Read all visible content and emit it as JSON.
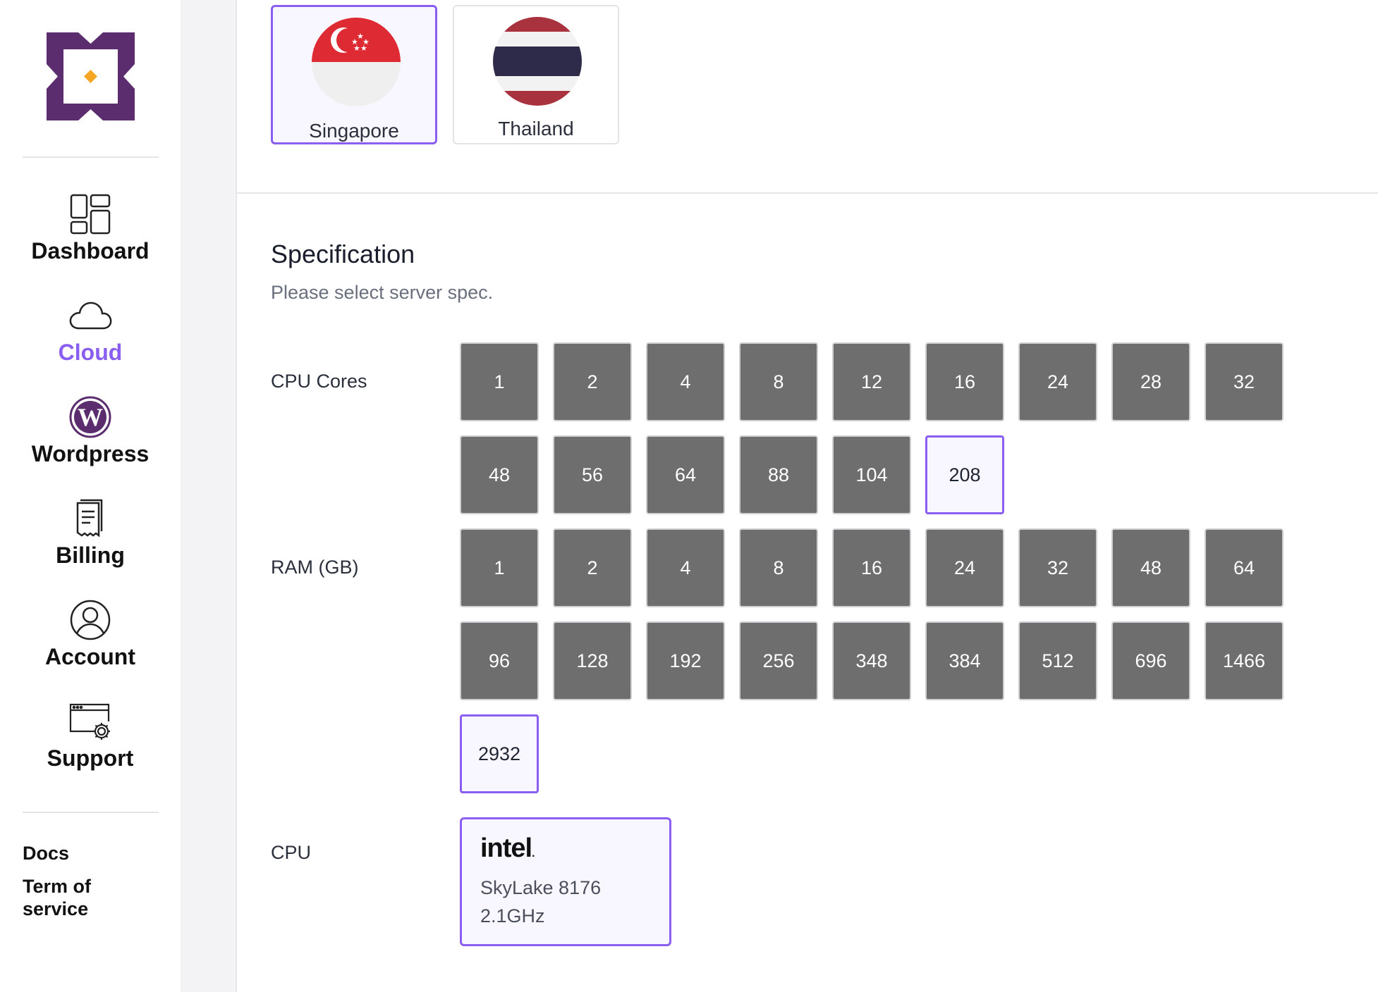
{
  "sidebar": {
    "nav": [
      {
        "label": "Dashboard",
        "icon": "dashboard-icon",
        "active": false
      },
      {
        "label": "Cloud",
        "icon": "cloud-icon",
        "active": true
      },
      {
        "label": "Wordpress",
        "icon": "wordpress-icon",
        "active": false
      },
      {
        "label": "Billing",
        "icon": "receipt-icon",
        "active": false
      },
      {
        "label": "Account",
        "icon": "user-circle-icon",
        "active": false
      },
      {
        "label": "Support",
        "icon": "browser-gear-icon",
        "active": false
      }
    ],
    "links": {
      "docs": "Docs",
      "terms": "Term of service"
    }
  },
  "regions": [
    {
      "name": "Singapore",
      "selected": true
    },
    {
      "name": "Thailand",
      "selected": false
    }
  ],
  "spec": {
    "title": "Specification",
    "subtitle": "Please select server spec.",
    "cpu_cores_label": "CPU Cores",
    "cpu_cores": [
      "1",
      "2",
      "4",
      "8",
      "12",
      "16",
      "24",
      "28",
      "32",
      "48",
      "56",
      "64",
      "88",
      "104",
      "208"
    ],
    "cpu_cores_selected": "208",
    "ram_label": "RAM (GB)",
    "ram": [
      "1",
      "2",
      "4",
      "8",
      "16",
      "24",
      "32",
      "48",
      "64",
      "96",
      "128",
      "192",
      "256",
      "348",
      "384",
      "512",
      "696",
      "1466",
      "2932"
    ],
    "ram_selected": "2932",
    "cpu_label": "CPU",
    "cpu": {
      "brand": "intel",
      "model": "SkyLake 8176",
      "frequency": "2.1GHz",
      "selected": true
    }
  },
  "colors": {
    "accent": "#8a5ef0",
    "option_bg": "#6e6e6e",
    "logo_purple": "#5b2d6e",
    "logo_diamond": "#f5a623"
  }
}
